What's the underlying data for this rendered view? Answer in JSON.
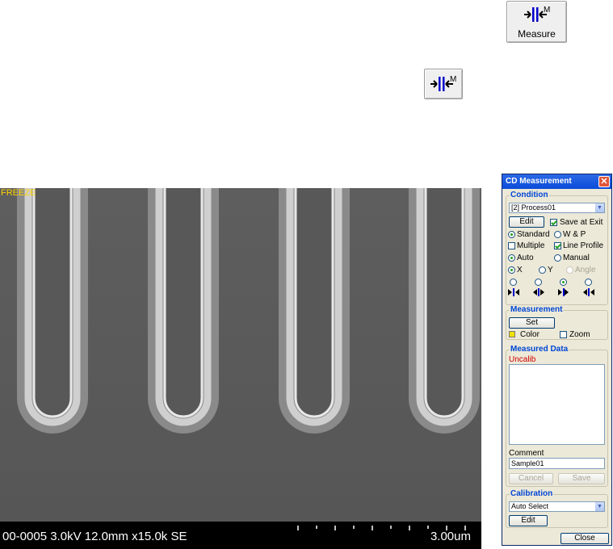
{
  "toolbar": {
    "measure_button_label": "Measure"
  },
  "sem": {
    "status": "FREEZE",
    "info": "00-0005 3.0kV 12.0mm x15.0k SE",
    "scale_label": "3.00um"
  },
  "dialog": {
    "title": "CD Measurement",
    "condition": {
      "title": "Condition",
      "selected": "[2] Process01",
      "edit_label": "Edit",
      "save_at_exit": "Save at Exit",
      "standard": "Standard",
      "wp": "W & P",
      "multiple": "Multiple",
      "line_profile": "Line Profile",
      "auto": "Auto",
      "manual": "Manual",
      "x": "X",
      "y": "Y",
      "angle": "Angle"
    },
    "measurement": {
      "title": "Measurement",
      "set_label": "Set",
      "color": "Color",
      "zoom": "Zoom"
    },
    "measured_data": {
      "title": "Measured Data",
      "status": "Uncalib",
      "comment_label": "Comment",
      "comment_value": "Sample01",
      "cancel_label": "Cancel",
      "save_label": "Save"
    },
    "calibration": {
      "title": "Calibration",
      "selected": "Auto Select",
      "edit_label": "Edit"
    },
    "close_label": "Close"
  },
  "colors": {
    "title_bar": "#0a4bd8",
    "group_title": "#0046d5",
    "uncalib": "#d00000",
    "freeze": "#ffd400"
  }
}
